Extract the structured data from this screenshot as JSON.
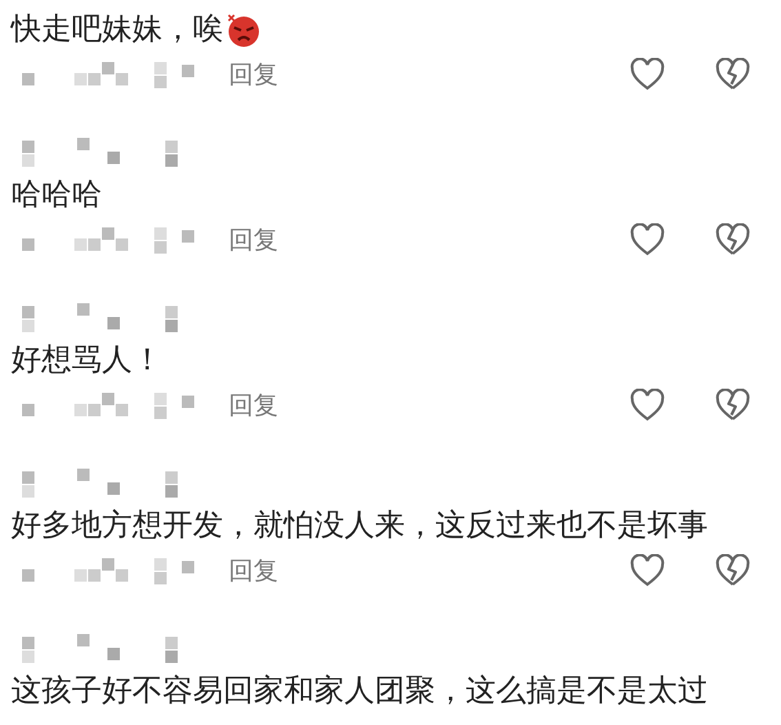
{
  "comments": [
    {
      "kind": "no_header",
      "text": "快走吧妹妹，唉",
      "sticker": true,
      "reply": "回复"
    },
    {
      "kind": "full",
      "text": "哈哈哈",
      "sticker": false,
      "reply": "回复"
    },
    {
      "kind": "full",
      "text": "好想骂人！",
      "sticker": false,
      "reply": "回复"
    },
    {
      "kind": "full",
      "text": "好多地方想开发，就怕没人来，这反过来也不是坏事",
      "sticker": false,
      "reply": "回复"
    },
    {
      "kind": "no_actions",
      "text": "这孩子好不容易回家和家人团聚，这么搞是不是太过",
      "sticker": false
    }
  ]
}
